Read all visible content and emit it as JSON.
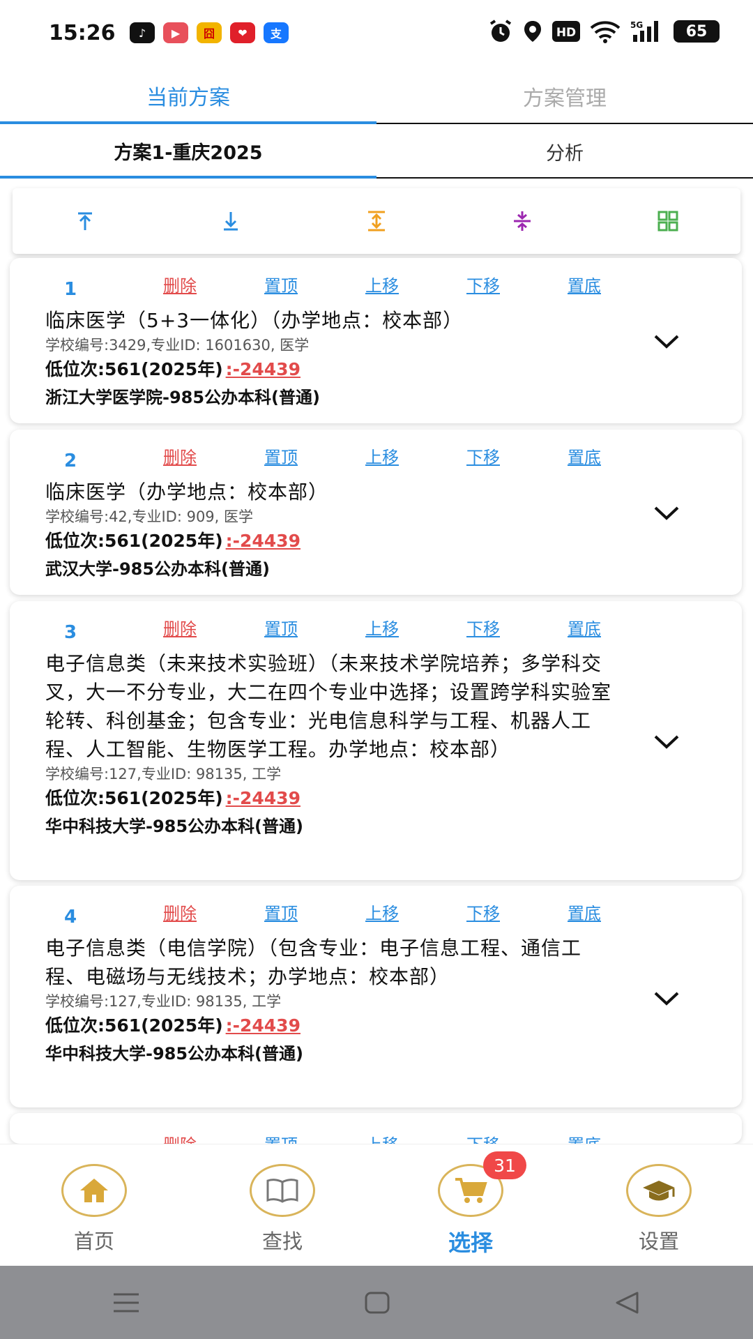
{
  "status_bar": {
    "time": "15:26",
    "apps": [
      {
        "icon": "tiktok-icon",
        "color": "#111111",
        "glyph": "♪"
      },
      {
        "icon": "video-icon",
        "color": "#e8505b",
        "glyph": "▶"
      },
      {
        "icon": "app-icon",
        "color": "#f2b400",
        "glyph": "囧"
      },
      {
        "icon": "heart-app-icon",
        "color": "#e0202a",
        "glyph": "❤"
      },
      {
        "icon": "alipay-icon",
        "color": "#1677ff",
        "glyph": "支"
      }
    ],
    "battery": "65"
  },
  "top_tabs": [
    "当前方案",
    "方案管理"
  ],
  "sub_tabs": [
    "方案1-重庆2025",
    "分析"
  ],
  "actions": {
    "delete": "删除",
    "top": "置顶",
    "up": "上移",
    "down": "下移",
    "bottom": "置底"
  },
  "items": [
    {
      "num": "1",
      "title": "临床医学（5+3一体化）（办学地点：校本部）",
      "meta": "学校编号:3429,专业ID: 1601630, 医学",
      "rank": "低位次:561(2025年)",
      "diff": ":-24439",
      "school": "浙江大学医学院-985公办本科(普通)"
    },
    {
      "num": "2",
      "title": "临床医学（办学地点：校本部）",
      "meta": "学校编号:42,专业ID: 909, 医学",
      "rank": "低位次:561(2025年)",
      "diff": ":-24439",
      "school": "武汉大学-985公办本科(普通)"
    },
    {
      "num": "3",
      "title": "电子信息类（未来技术实验班）（未来技术学院培养；多学科交叉，大一不分专业，大二在四个专业中选择；设置跨学科实验室轮转、科创基金；包含专业：光电信息科学与工程、机器人工程、人工智能、生物医学工程。办学地点：校本部）",
      "meta": "学校编号:127,专业ID: 98135, 工学",
      "rank": "低位次:561(2025年)",
      "diff": ":-24439",
      "school": "华中科技大学-985公办本科(普通)"
    },
    {
      "num": "4",
      "title": "电子信息类（电信学院）（包含专业：电子信息工程、通信工程、电磁场与无线技术；办学地点：校本部）",
      "meta": "学校编号:127,专业ID: 98135, 工学",
      "rank": "低位次:561(2025年)",
      "diff": ":-24439",
      "school": "华中科技大学-985公办本科(普通)"
    }
  ],
  "bottom_nav": {
    "items": [
      "首页",
      "查找",
      "选择",
      "设置"
    ],
    "cart_badge": "31"
  },
  "colors": {
    "accent": "#2a8de0",
    "danger": "#e24b4b",
    "gold": "#d9b45a"
  }
}
